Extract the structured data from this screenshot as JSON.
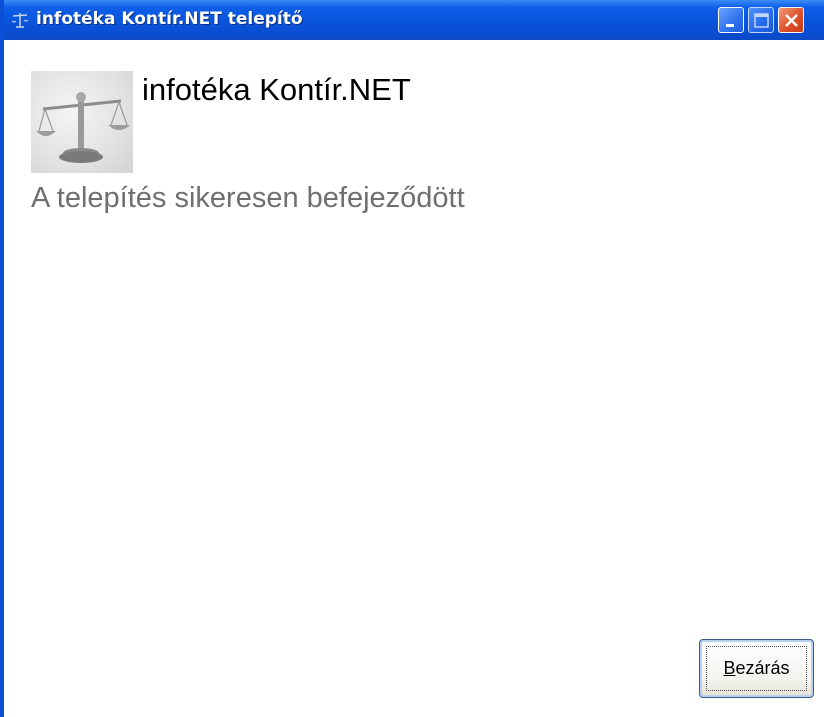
{
  "window": {
    "title": "infotéka Kontír.NET telepítő",
    "controls": {
      "minimize_icon": "minimize-icon",
      "maximize_icon": "maximize-icon",
      "close_icon": "close-icon"
    },
    "colors": {
      "titlebar": "#0a55de",
      "close_button": "#e0522b",
      "status_text": "#6f6f6f"
    }
  },
  "header": {
    "logo_icon": "scales-of-justice-icon",
    "product_name": "infotéka Kontír.NET"
  },
  "main": {
    "status_message": "A telepítés sikeresen befejeződött"
  },
  "footer": {
    "close_button": {
      "mnemonic": "B",
      "rest": "ezárás"
    }
  }
}
